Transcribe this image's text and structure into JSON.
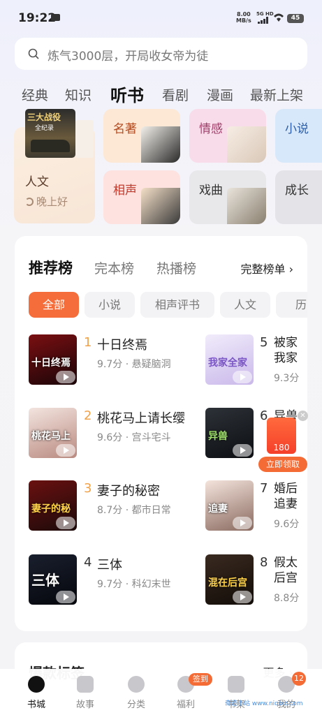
{
  "status": {
    "time": "19:22",
    "speed_value": "8.00",
    "speed_unit": "MB/s",
    "network": "5G HD",
    "battery": "45"
  },
  "search": {
    "placeholder": "炼气3000层，开局收女帝为徒"
  },
  "top_tabs": [
    "经典",
    "知识",
    "听书",
    "看剧",
    "漫画",
    "最新上架"
  ],
  "active_tab": "听书",
  "featured": {
    "cover_title": "三大战役",
    "cover_sub": "全纪录",
    "label": "人文",
    "sub": "晚上好"
  },
  "categories": [
    {
      "label": "名著",
      "color": "#b34a1f",
      "bg": "#fde8d6"
    },
    {
      "label": "情感",
      "color": "#a0406a",
      "bg": "#f8dcea"
    },
    {
      "label": "小说",
      "color": "#2b5ea8",
      "bg": "#d8e8fb"
    },
    {
      "label": "相声",
      "color": "#c0392b",
      "bg": "#fde2df"
    },
    {
      "label": "戏曲",
      "color": "#333333",
      "bg": "#e8e8ea"
    },
    {
      "label": "成长",
      "color": "#333333",
      "bg": "#e4e4e8"
    }
  ],
  "ranking": {
    "tabs": [
      "推荐榜",
      "完本榜",
      "热播榜"
    ],
    "full_link": "完整榜单",
    "chips": [
      "全部",
      "小说",
      "相声评书",
      "人文",
      "历"
    ],
    "books": [
      {
        "rank": "1",
        "title": "十日终焉",
        "meta": "9.7分 · 悬疑脑洞",
        "cover_text": "十日终焉"
      },
      {
        "rank": "2",
        "title": "桃花马上请长缨",
        "meta": "9.6分 · 宫斗宅斗",
        "cover_text": "桃花马上"
      },
      {
        "rank": "3",
        "title": "妻子的秘密",
        "meta": "8.7分 · 都市日常",
        "cover_text": "妻子的秘"
      },
      {
        "rank": "4",
        "title": "三体",
        "meta": "9.7分 · 科幻末世",
        "cover_text": "三体"
      },
      {
        "rank": "5",
        "title": "被家我家",
        "meta": "9.3分",
        "cover_text": "我家全家"
      },
      {
        "rank": "6",
        "title": "异兽",
        "meta": "",
        "cover_text": "异兽"
      },
      {
        "rank": "7",
        "title": "婚后追妻",
        "meta": "9.6分",
        "cover_text": "追妻"
      },
      {
        "rank": "8",
        "title": "假太后宫",
        "meta": "8.8分",
        "cover_text": "混在后宫"
      }
    ]
  },
  "reward": {
    "amount": "180",
    "button": "立即领取"
  },
  "next_section": {
    "title": "爆款标签",
    "more": "更多"
  },
  "nav": {
    "items": [
      "书城",
      "故事",
      "分类",
      "福利",
      "书架",
      "我的"
    ],
    "welfare_badge": "签到",
    "mine_badge": "12"
  },
  "watermark": "奇迹小站 www.niqixz.com",
  "colors": {
    "accent": "#f46d3a",
    "rank_top": "#f0a24a",
    "rank_other": "#333333"
  }
}
